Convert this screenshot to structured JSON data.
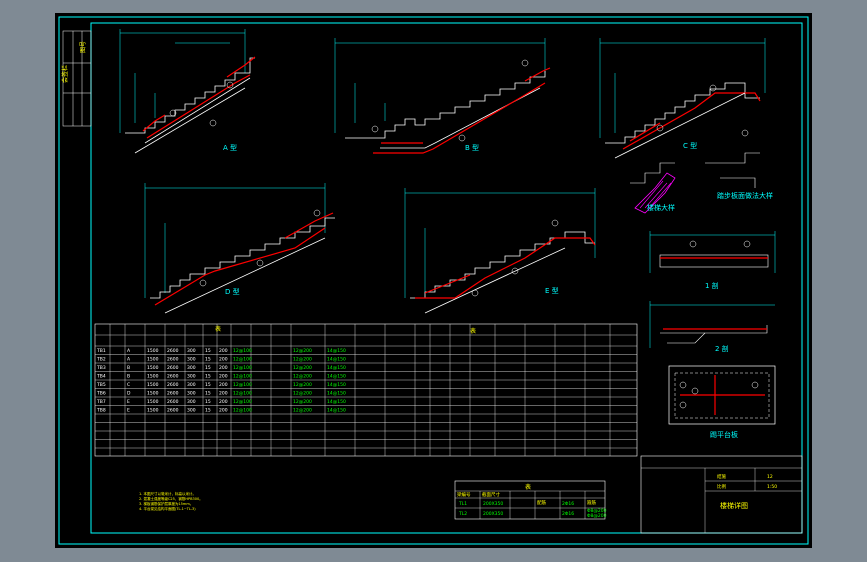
{
  "viewport": {
    "background": "#000000"
  },
  "colors": {
    "frame": "#00ffff",
    "line": "#ffffff",
    "dim": "#00ffff",
    "rebar": "#ff0000",
    "hatch": "#ff00ff",
    "text": "#ffff00",
    "green": "#00ff00"
  },
  "stair_types": [
    {
      "caption": "A 型"
    },
    {
      "caption": "B 型"
    },
    {
      "caption": "C 型"
    },
    {
      "caption": "D 型"
    },
    {
      "caption": "E 型"
    }
  ],
  "details": {
    "left_caption": "楼梯大样",
    "right_caption": "踏步板面做法大样",
    "section1_caption": "1 剖",
    "section2_caption": "2 剖",
    "plan_caption": "踢平台板"
  },
  "schedule": {
    "header_left": "表",
    "header_right": "表",
    "rows": [
      [
        "TB1",
        "A",
        "1500",
        "2600",
        "300",
        "15",
        "200",
        "12@100",
        "",
        "",
        "12@200",
        "14@150"
      ],
      [
        "TB2",
        "A",
        "1500",
        "2600",
        "300",
        "15",
        "200",
        "12@100",
        "",
        "",
        "12@200",
        "14@150"
      ],
      [
        "TB3",
        "B",
        "1500",
        "2600",
        "300",
        "15",
        "200",
        "12@100",
        "",
        "",
        "12@200",
        "14@150"
      ],
      [
        "TB4",
        "B",
        "1500",
        "2600",
        "300",
        "15",
        "200",
        "12@100",
        "",
        "",
        "12@200",
        "14@150"
      ],
      [
        "TB5",
        "C",
        "1500",
        "2600",
        "300",
        "15",
        "200",
        "12@100",
        "",
        "",
        "12@200",
        "14@150"
      ],
      [
        "TB6",
        "D",
        "1500",
        "2600",
        "300",
        "15",
        "200",
        "12@100",
        "",
        "",
        "12@200",
        "14@150"
      ],
      [
        "TB7",
        "E",
        "1500",
        "2600",
        "300",
        "15",
        "200",
        "12@100",
        "",
        "",
        "12@200",
        "14@150"
      ],
      [
        "TB8",
        "E",
        "1500",
        "2600",
        "300",
        "15",
        "200",
        "12@100",
        "",
        "",
        "12@200",
        "14@150"
      ]
    ]
  },
  "notes": [
    "1. 本图尺寸以毫米计，标高以米计。",
    "2. 混凝土强度等级C25，钢筋HPB300。",
    "3. 梯板钢筋保护层厚度为15mm。",
    "4. 平台梁见结构平面图(TL-1~TL-3)"
  ],
  "beam_table": {
    "title": "表",
    "header": [
      "梁编号",
      "截面尺寸",
      "配筋",
      "箍筋"
    ],
    "rows": [
      [
        "TL1",
        "200X350",
        "2Φ16",
        "Φ8@200"
      ],
      [
        "TL2",
        "200X350",
        "2Φ16",
        "Φ8@200"
      ]
    ]
  },
  "title_block": {
    "drawing_name": "楼梯详图",
    "sheet_label": "结施",
    "sheet_no": "12",
    "scale_label": "比例",
    "scale_value": "1:50"
  },
  "side_strip": {
    "label1": "会签栏",
    "label2": "图号"
  }
}
